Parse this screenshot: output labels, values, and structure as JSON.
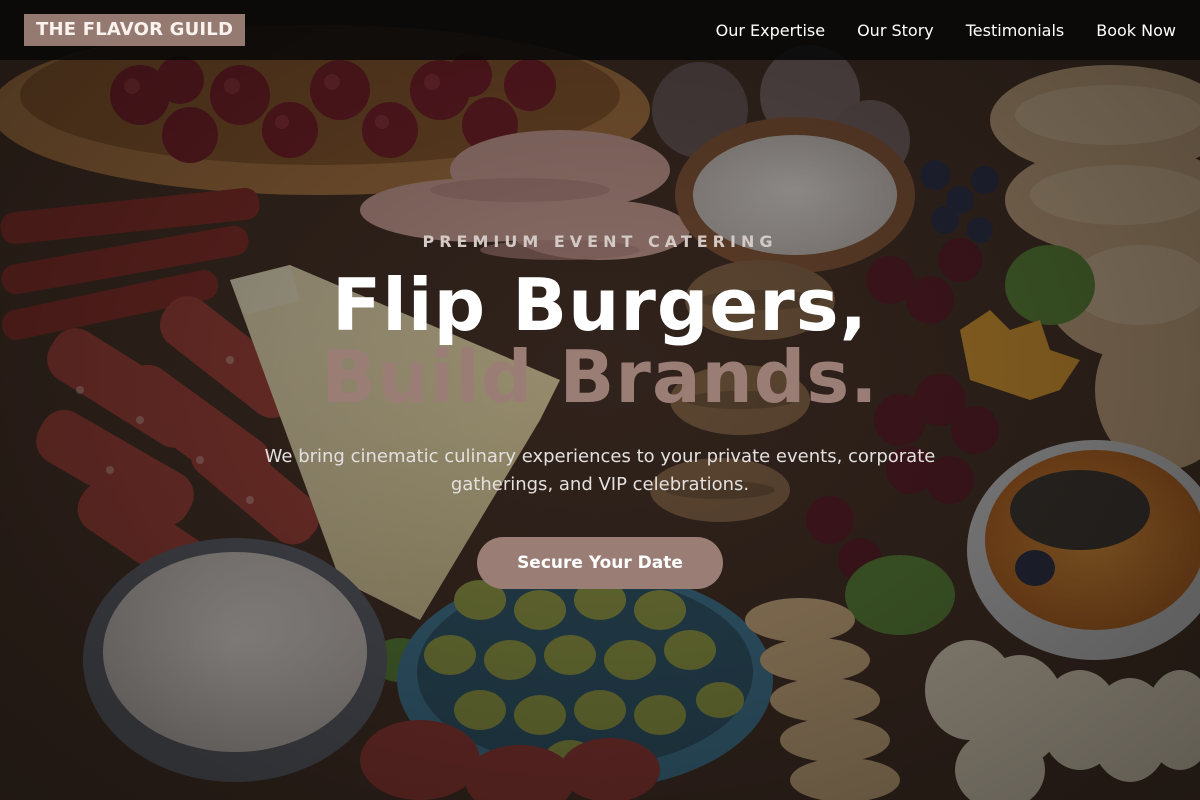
{
  "brand": {
    "name": "THE FLAVOR GUILD"
  },
  "nav": {
    "items": [
      {
        "label": "Our Expertise"
      },
      {
        "label": "Our Story"
      },
      {
        "label": "Testimonials"
      },
      {
        "label": "Book Now"
      }
    ]
  },
  "hero": {
    "background_image": "charcuterie-board-photo",
    "eyebrow": "PREMIUM EVENT CATERING",
    "headline_line1": "Flip Burgers,",
    "headline_line2": "Build Brands.",
    "subtext": "We bring cinematic culinary experiences to your private events, corporate gatherings, and VIP celebrations.",
    "cta_label": "Secure Your Date"
  },
  "colors": {
    "accent": "#9a7e76",
    "logo_bg": "#957a72",
    "nav_bg": "#080808",
    "text_light": "#ffffff"
  }
}
